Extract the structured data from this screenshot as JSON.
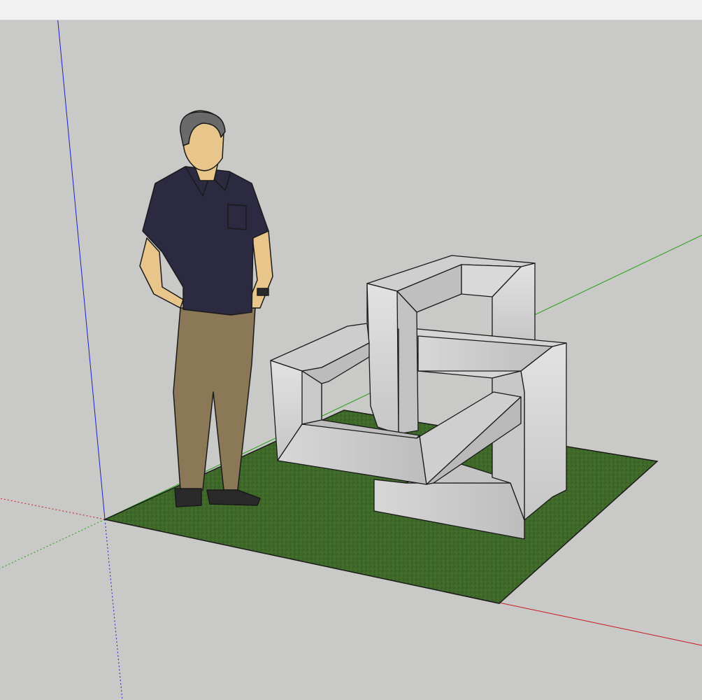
{
  "viewport": {
    "background": "#c9c9c7",
    "top_bar": "#f1f1f1"
  },
  "axes": {
    "red": "#c8181e",
    "green": "#25a012",
    "blue": "#1a22c8"
  },
  "colors": {
    "grass": "#3f6a2a",
    "grass_dark": "#2d5220",
    "sculpture_top": "#c9c9c9",
    "sculpture_side": "#dadada",
    "sculpture_shadow": "#aaaaaa",
    "outline": "#1a1a1a",
    "shirt": "#2b2a40",
    "pants": "#8a7856",
    "skin": "#e8c58a",
    "hair": "#6a6a6a",
    "shoes": "#2a2a2a"
  },
  "scene": {
    "figure": "human-scale-figure",
    "object": "interlocking-square-frames",
    "ground": "grass-plane"
  }
}
